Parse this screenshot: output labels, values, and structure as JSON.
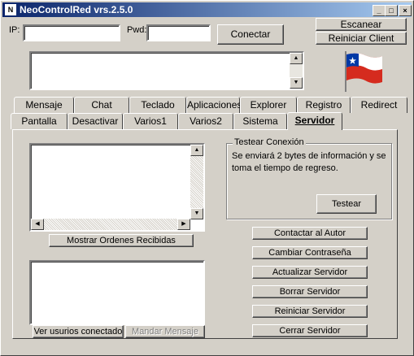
{
  "window": {
    "app_icon": "N",
    "title": "NeoControlRed vrs.2.5.0",
    "minimize_glyph": "_",
    "maximize_glyph": "□",
    "close_glyph": "×"
  },
  "connection": {
    "ip_label": "IP:",
    "ip_value": "",
    "pwd_label": "Pwd:",
    "pwd_value": "",
    "connect_label": "Conectar",
    "scan_label": "Escanear",
    "restart_client_label": "Reiniciar Client"
  },
  "flag": {
    "icon": "chile-flag-icon"
  },
  "tabs_row1": [
    "Mensaje",
    "Chat",
    "Teclado",
    "Aplicaciones",
    "Explorer",
    "Registro",
    "Redirect"
  ],
  "tabs_row2": [
    "Pantalla",
    "Desactivar",
    "Varios1",
    "Varios2",
    "Sistema",
    "Servidor"
  ],
  "active_tab": "Servidor",
  "servidor": {
    "show_orders_label": "Mostrar Ordenes Recibidas",
    "test_group_caption": "Testear Conexión",
    "test_description": "Se enviará 2 bytes de información y se toma el tiempo de regreso.",
    "test_button": "Testear",
    "actions": [
      "Contactar al Autor",
      "Cambiar Contraseña",
      "Actualizar Servidor",
      "Borrar Servidor",
      "Reiniciar Servidor",
      "Cerrar Servidor"
    ],
    "connected_users_label": "Ver usurios conectado",
    "send_message_label": "Mandar Mensaje"
  }
}
